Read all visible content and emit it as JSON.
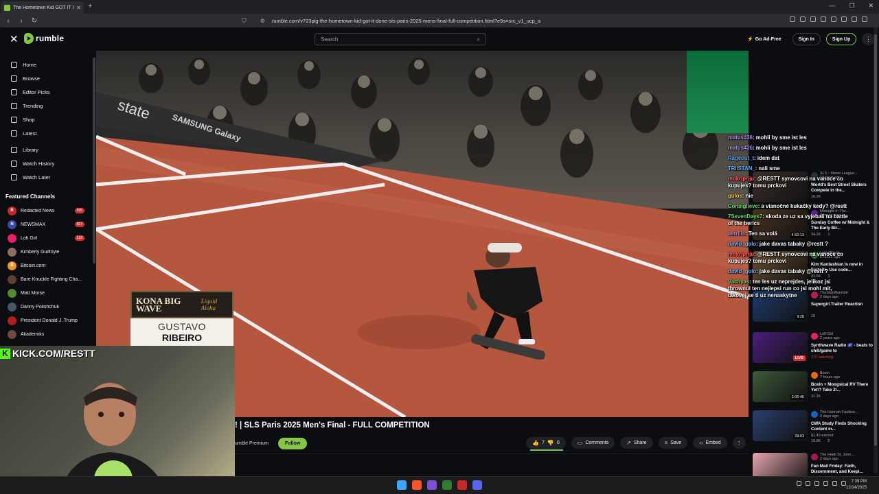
{
  "browser": {
    "tab_title": "The Hometown Kid GOT IT D...",
    "url": "rumble.com/v723plg-the-hometown-kid-got-it-done-sls-paris-2025-mens-final-full-competition.html?e9s=src_v1_ucp_a"
  },
  "header": {
    "logo_text": "rumble",
    "search_placeholder": "Search",
    "go_ad_free": "Go Ad-Free",
    "sign_in": "Sign In",
    "sign_up": "Sign Up"
  },
  "sidebar": {
    "nav": [
      {
        "label": "Home",
        "icon": "home-icon"
      },
      {
        "label": "Browse",
        "icon": "browse-icon"
      },
      {
        "label": "Editor Picks",
        "icon": "editor-picks-icon"
      },
      {
        "label": "Trending",
        "icon": "trending-icon"
      },
      {
        "label": "Shop",
        "icon": "shop-icon"
      },
      {
        "label": "Latest",
        "icon": "latest-icon"
      }
    ],
    "library": [
      {
        "label": "Library",
        "icon": "library-icon"
      },
      {
        "label": "Watch History",
        "icon": "history-icon"
      },
      {
        "label": "Watch Later",
        "icon": "watch-later-icon"
      }
    ],
    "featured_heading": "Featured Channels",
    "channels": [
      {
        "name": "Redacted News",
        "badge": "595",
        "color": "#c62828",
        "initial": "R"
      },
      {
        "name": "NEWSMAX",
        "badge": "507",
        "color": "#3949ab",
        "initial": "N"
      },
      {
        "name": "Lofi Girl",
        "badge": "318",
        "color": "#e91e63",
        "initial": ""
      },
      {
        "name": "Kimberly Guilfoyle",
        "badge": "",
        "color": "#8d6e63",
        "initial": ""
      },
      {
        "name": "Bitcoin.com",
        "badge": "",
        "color": "#f7931a",
        "initial": "B"
      },
      {
        "name": "Bare Knuckle Fighting Cha...",
        "badge": "",
        "color": "#5d4037",
        "initial": ""
      },
      {
        "name": "Matt Morse",
        "badge": "",
        "color": "#558b2f",
        "initial": ""
      },
      {
        "name": "Danny Polishchuk",
        "badge": "",
        "color": "#455a64",
        "initial": ""
      },
      {
        "name": "President Donald J. Trump",
        "badge": "",
        "color": "#b71c1c",
        "initial": ""
      },
      {
        "name": "Akademiks",
        "badge": "",
        "color": "#6d4c41",
        "initial": ""
      }
    ]
  },
  "video": {
    "lower_third_sponsor": "KONA BIG WAVE",
    "lower_third_sponsor_tag": "Liquid Aloha",
    "lower_third_first": "GUSTAVO",
    "lower_third_last": "RIBEIRO",
    "wall_text_1": "state",
    "wall_text_2": "SAMSUNG Galaxy"
  },
  "overlay": {
    "kick_label": "KICK.COM/RESTT"
  },
  "below": {
    "title": "! | SLS Paris 2025 Men's Final - FULL COMPETITION",
    "channel_fragment": "umble Premium",
    "follow": "Follow",
    "upvotes": "7",
    "downvotes": "0",
    "comments": "Comments",
    "share": "Share",
    "save": "Save",
    "embed": "Embed"
  },
  "chat": [
    {
      "user": "matus436",
      "color": "#a98ce6",
      "msg": "mohli by sme ist les"
    },
    {
      "user": "matus436",
      "color": "#a98ce6",
      "msg": "mohli by sme ist les"
    },
    {
      "user": "Rageout_t",
      "color": "#5aa9ff",
      "msg": "idem dat"
    },
    {
      "user": "TRIISTAN_",
      "color": "#5aa9ff",
      "msg": "nali sme"
    },
    {
      "user": "mokripriju",
      "color": "#ff5b5b",
      "msg": "@RESTT synovcovi na vanoce co kupujes? tomu prckovi"
    },
    {
      "user": "gulos",
      "color": "#f5d142",
      "msg": "nie"
    },
    {
      "user": "Consiglieve",
      "color": "#6bd86b",
      "msg": "a vianočné kukačky kedy? @restt"
    },
    {
      "user": "7SevenDays7",
      "color": "#6bd86b",
      "msg": "skoda ze uz sa vyjebali na battle of the berics"
    },
    {
      "user": "astrilis",
      "color": "#a98ce6",
      "msg": "Teo sa volá"
    },
    {
      "user": "david_golo",
      "color": "#6fb4ff",
      "msg": "jake davas tabaky @restt ?"
    },
    {
      "user": "mokripriju",
      "color": "#ff5b5b",
      "msg": "@RESTT synovcovi na vanoce co kupujes? tomu prckovi"
    },
    {
      "user": "david_golo",
      "color": "#6fb4ff",
      "msg": "jake davas tabaky @restt ?"
    },
    {
      "user": "Vachyas",
      "color": "#6bd86b",
      "msg": "ten les uz neprejdes, jelikoz jsi thrownul ten nejlepsi run co jsi mohl mit, takovej se ti uz nenaskytne"
    }
  ],
  "related": [
    {
      "channel": "SLS - Street League...",
      "age": "18 days ago",
      "title": "World's Best Street Skaters Compete in the...",
      "views": "10.2K",
      "comments": "",
      "duration": "",
      "live": false,
      "watching": "",
      "thumb": "#3a2e2a",
      "avatar": "#263238"
    },
    {
      "channel": "Midnight In The...",
      "age": "6 hours ago",
      "title": "Sunday Coffee w/ Midnight & The Early Bir...",
      "views": "34.2K",
      "comments": "1",
      "duration": "4:52:13",
      "live": false,
      "watching": "",
      "thumb": "#4a3320",
      "avatar": "#6a1b9a"
    },
    {
      "channel": "LethalPinda",
      "age": "8 hours ago",
      "title": "Kim Kardashian is now in Fortnite. Use code...",
      "views": "33.6K",
      "comments": "3",
      "duration": "",
      "live": false,
      "watching": "",
      "thumb": "#6b4f33",
      "avatar": "#2e7d32"
    },
    {
      "channel": "TheStarWarsGirl",
      "age": "2 days ago",
      "title": "Supergirl Trailer Reaction",
      "views": "",
      "comments": "10",
      "duration": "9:28",
      "live": false,
      "watching": "",
      "thumb": "#1e3b6b",
      "avatar": "#c2185b"
    },
    {
      "channel": "Lofi Girl",
      "age": "2 years ago",
      "title": "Synthwave Radio 🌌 - beats to chill/game to",
      "views": "",
      "comments": "",
      "duration": "",
      "live": true,
      "watching": "270 watching",
      "thumb": "#4a1f7a",
      "avatar": "#e91e63"
    },
    {
      "channel": "Boxin",
      "age": "7 hours ago",
      "title": "Boxin + Moogsical RV There Yet!? Take 2!...",
      "views": "31.2K",
      "comments": "",
      "duration": "3:06:46",
      "live": false,
      "watching": "",
      "thumb": "#3d5a3a",
      "avatar": "#ef6c00"
    },
    {
      "channel": "The Hannah Faulkne...",
      "age": "2 days ago",
      "title": "CWA Study Finds Shocking Content in...",
      "views": "19.8K",
      "comments": "5",
      "duration": "28:03",
      "live": false,
      "watching": "$1.43 earned",
      "thumb": "#2b3f6e",
      "avatar": "#1565c0"
    },
    {
      "channel": "The Heidi St. John...",
      "age": "2 days ago",
      "title": "Fan Mail Friday: Faith, Discernment, and Keepi...",
      "views": "",
      "comments": "",
      "duration": "",
      "live": false,
      "watching": "",
      "thumb": "#e8a7b0",
      "avatar": "#ad1457"
    }
  ],
  "taskbar": {
    "time": "7:39 PM",
    "date": "12/14/2025"
  }
}
